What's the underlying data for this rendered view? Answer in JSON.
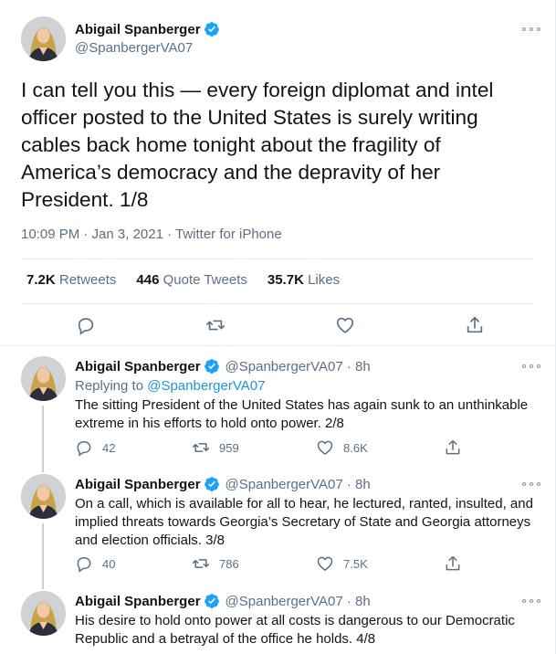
{
  "author": {
    "display_name": "Abigail Spanberger",
    "handle": "@SpanbergerVA07"
  },
  "main_tweet": {
    "text": "I can tell you this — every foreign diplomat and intel officer posted to the United States is surely writing cables back home tonight about the fragility of America’s democracy and the depravity of her President. 1/8",
    "meta": "10:09 PM · Jan 3, 2021 · Twitter for iPhone",
    "stats": {
      "retweets_count": "7.2K",
      "retweets_label": "Retweets",
      "quotes_count": "446",
      "quotes_label": "Quote Tweets",
      "likes_count": "35.7K",
      "likes_label": "Likes"
    }
  },
  "replies": [
    {
      "display_name": "Abigail Spanberger",
      "handle_time": "@SpanbergerVA07 · 8h",
      "replying_prefix": "Replying to ",
      "replying_to": "@SpanbergerVA07",
      "text": "The sitting President of the United States has again sunk to an unthinkable extreme in his efforts to hold onto power. 2/8",
      "replies": "42",
      "retweets": "959",
      "likes": "8.6K"
    },
    {
      "display_name": "Abigail Spanberger",
      "handle_time": "@SpanbergerVA07 · 8h",
      "text": "On a call, which is available for all to hear, he lectured, ranted, insulted, and implied threats towards Georgia’s Secretary of State and Georgia attorneys and election officials. 3/8",
      "replies": "40",
      "retweets": "786",
      "likes": "7.5K"
    },
    {
      "display_name": "Abigail Spanberger",
      "handle_time": "@SpanbergerVA07 · 8h",
      "text": "His desire to hold onto power at all costs is dangerous to our Democratic Republic and a betrayal of the office he holds. 4/8"
    }
  ],
  "colors": {
    "accent": "#1b95e0",
    "secondary_text": "#5b7083",
    "icon": "#5b7083",
    "verified": "#1da1f2"
  },
  "icons": [
    "verified-badge-icon",
    "more-icon",
    "reply-icon",
    "retweet-icon",
    "like-icon",
    "share-icon"
  ]
}
